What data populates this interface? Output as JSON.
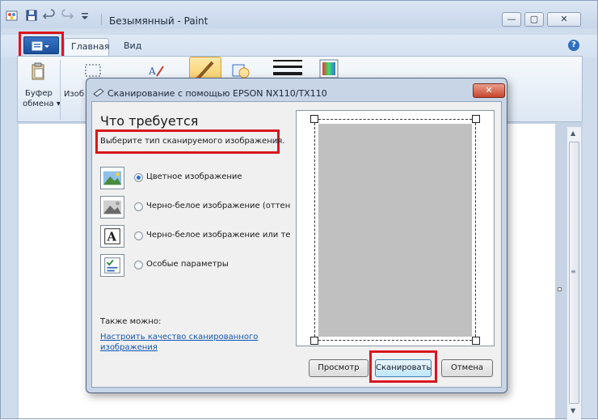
{
  "window": {
    "title": "Безымянный - Paint",
    "controls": {
      "minimize": "—",
      "maximize": "▢",
      "close": "✕"
    }
  },
  "ribbon": {
    "tabs": [
      {
        "label": "Главная"
      },
      {
        "label": "Вид"
      }
    ],
    "help_icon": "?",
    "clipboard_label_line1": "Буфер",
    "clipboard_label_line2": "обмена ▾",
    "image_label": "Изоб"
  },
  "dialog": {
    "title": "Сканирование с помощью EPSON NX110/TX110",
    "close_label": "✕",
    "heading": "Что требуется",
    "instruction": "Выберите тип сканируемого изображения.",
    "options": [
      {
        "label": "Цветное изображение",
        "checked": true,
        "icon": "color-photo-icon"
      },
      {
        "label": "Черно-белое изображение (оттенки серого)",
        "checked": false,
        "icon": "grayscale-photo-icon"
      },
      {
        "label": "Черно-белое изображение или текст",
        "checked": false,
        "icon": "bw-text-icon"
      },
      {
        "label": "Особые параметры",
        "checked": false,
        "icon": "custom-settings-icon"
      }
    ],
    "also_label": "Также можно:",
    "quality_link": "Настроить качество сканированного изображения",
    "buttons": {
      "preview": "Просмотр",
      "scan": "Сканировать",
      "cancel": "Отмена"
    }
  },
  "colors": {
    "highlight_red": "#d9161e",
    "link_blue": "#1356b3",
    "preview_gray": "#c0c0c0"
  }
}
